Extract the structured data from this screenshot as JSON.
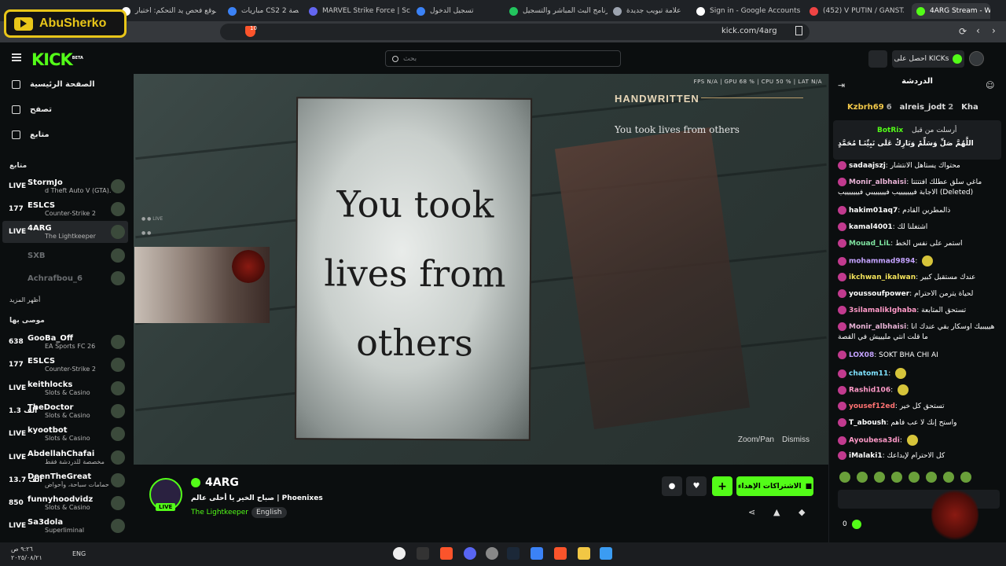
{
  "browser": {
    "tabs": [
      {
        "label": "موقع فحص يد التحكم: اختبار",
        "color": "#ffffff"
      },
      {
        "label": "مباريات CS2 المخصصة 2x",
        "color": "#3b82f6"
      },
      {
        "label": "MARVEL Strike Force | Sc",
        "color": "#6366f1"
      },
      {
        "label": "تسجيل الدخول",
        "color": "#3b82f6"
      },
      {
        "label": "برنامج البث المباشر والتسجيل",
        "color": "#22c55e"
      },
      {
        "label": "علامة تبويب جديدة",
        "color": "#9ca3af"
      },
      {
        "label": "Sign in - Google Accounts",
        "color": "#ffffff"
      },
      {
        "label": "(452) V PUTIN / GANSTA",
        "color": "#ef4444"
      },
      {
        "label": "4ARG Stream - Wa",
        "color": "#53fc18"
      }
    ],
    "url": "kick.com/4arg",
    "shield_count": "10"
  },
  "overlay_badge": {
    "channel": "AbuSherko"
  },
  "header": {
    "logo": "KICK",
    "logo_sup": "BETA",
    "search_placeholder": "بحث",
    "kicks_button": "احصل على KICKs"
  },
  "sidebar": {
    "nav": [
      {
        "label": "الصفحة الرئيسية",
        "icon": "home-icon"
      },
      {
        "label": "تصفح",
        "icon": "browse-icon"
      },
      {
        "label": "متابع",
        "icon": "heart-icon"
      }
    ],
    "following_heading": "متابع",
    "following": [
      {
        "count": "LIVE",
        "name": "StormJo",
        "category": "d Theft Auto V (GTA)...",
        "live": true,
        "selected": false
      },
      {
        "count": "177",
        "name": "ESLCS",
        "category": "Counter-Strike 2",
        "live": true,
        "selected": false
      },
      {
        "count": "LIVE",
        "name": "4ARG",
        "category": "The Lightkeeper",
        "live": true,
        "selected": true
      },
      {
        "count": "",
        "name": "SXB",
        "category": "",
        "live": false,
        "selected": false
      },
      {
        "count": "",
        "name": "Achrafbou_6",
        "category": "",
        "live": false,
        "selected": false
      }
    ],
    "show_more": "أظهر المزيد",
    "recommended_heading": "موصى بها",
    "recommended": [
      {
        "count": "638",
        "name": "GooBa_Off",
        "category": "EA Sports FC 26"
      },
      {
        "count": "177",
        "name": "ESLCS",
        "category": "Counter-Strike 2"
      },
      {
        "count": "LIVE",
        "name": "keithlocks",
        "category": "Slots & Casino"
      },
      {
        "count": "1.3 ألف",
        "name": "TheDoctor",
        "category": "Slots & Casino"
      },
      {
        "count": "LIVE",
        "name": "kyootbot",
        "category": "Slots & Casino"
      },
      {
        "count": "LIVE",
        "name": "AbdellahChafai",
        "category": "مخصصة للدردشة فقط"
      },
      {
        "count": "13.7 ألف",
        "name": "DeenTheGreat",
        "category": "حمامات سباحة، وأحواض ..."
      },
      {
        "count": "850",
        "name": "funnyhoodvidz",
        "category": "Slots & Casino"
      },
      {
        "count": "LIVE",
        "name": "Sa3dola",
        "category": "Superliminal"
      }
    ]
  },
  "video": {
    "perf": "FPS N/A  |  GPU 68 %  |  CPU 50 %  |  LAT N/A",
    "hud_title": "HANDWRITTEN",
    "hud_text": "You took lives from others",
    "note_text": "You took lives from others",
    "prompt_zoom": "Zoom/Pan",
    "prompt_dismiss": "Dismiss"
  },
  "channel": {
    "name": "4ARG",
    "live": "LIVE",
    "title": "صباح الخير يا أحلى عالم | Phoenixes",
    "category": "The Lightkeeper",
    "language": "English",
    "gift_button": "الاشتراكات الإهداء",
    "plus_button": "+"
  },
  "chat": {
    "heading": "الدردشة",
    "top_gifters": [
      {
        "name": "Kzbrh69",
        "count": "6"
      },
      {
        "name": "alreis_jodt",
        "count": "2"
      },
      {
        "name": "Kha",
        "count": ""
      }
    ],
    "pinned": {
      "user": "BotRix",
      "label": "أرسلت من قبل",
      "message": "اللَّهُمَّ صَلِّ وَسَلِّمْ وَبَارِكْ عَلَى نَبِيِّنَـا مُحَمَّدٍ"
    },
    "messages": [
      {
        "user": "sadaajszj",
        "color": "#ffffff",
        "text": "محتواك يستاهل الانتشار"
      },
      {
        "user": "Monir_albhaisi",
        "color": "#e8b3d6",
        "text": "ماغي سلق عطلك افتتتتا الاجابة فيييييييب فييييييبي فيييييييب (Deleted)"
      },
      {
        "user": "hakim01aq7",
        "color": "#ffffff",
        "text": "ذالمطرين القادم"
      },
      {
        "user": "kamal4001",
        "color": "#ffffff",
        "text": "اشتغلنا لك"
      },
      {
        "user": "Mouad_LiL",
        "color": "#7fe3a0",
        "text": "استمر على نفس الخط"
      },
      {
        "user": "mohammad9894",
        "color": "#c4a3ff",
        "text": ""
      },
      {
        "user": "ikchwan_ikalwan",
        "color": "#f3e35a",
        "text": "عندك مستقبل كبير"
      },
      {
        "user": "youssoufpower",
        "color": "#ffffff",
        "text": "لحياة يترمن الاحترام"
      },
      {
        "user": "3silamalikIghaba",
        "color": "#ff9ac8",
        "text": "تستحق المتابعة"
      },
      {
        "user": "Monir_albhaisi",
        "color": "#e8b3d6",
        "text": "هيييبيك اوسكار بقي عندك انا ما قلت انتي مليييش في القصة"
      },
      {
        "user": "LOX08",
        "color": "#c4a3ff",
        "text": "SOKT BHA CHI AI"
      },
      {
        "user": "chatom11",
        "color": "#7fe3ff",
        "text": ""
      },
      {
        "user": "Rashid106",
        "color": "#ff9ac8",
        "text": ""
      },
      {
        "user": "yousef12ed",
        "color": "#ff7272",
        "text": "تستحق كل خير"
      },
      {
        "user": "T_aboush",
        "color": "#ffffff",
        "text": "واستح إنك لا عب فاهم"
      },
      {
        "user": "Ayoubesa3di",
        "color": "#ff9ac8",
        "text": ""
      },
      {
        "user": "iMalaki1",
        "color": "#ffffff",
        "text": "كل الاحترام لإبداعك"
      }
    ],
    "kicks_count": "0"
  },
  "taskbar": {
    "time": "٩:٢٦ ص",
    "date": "٢٠٢٥/٠٨/٢١",
    "lang": "ENG"
  }
}
